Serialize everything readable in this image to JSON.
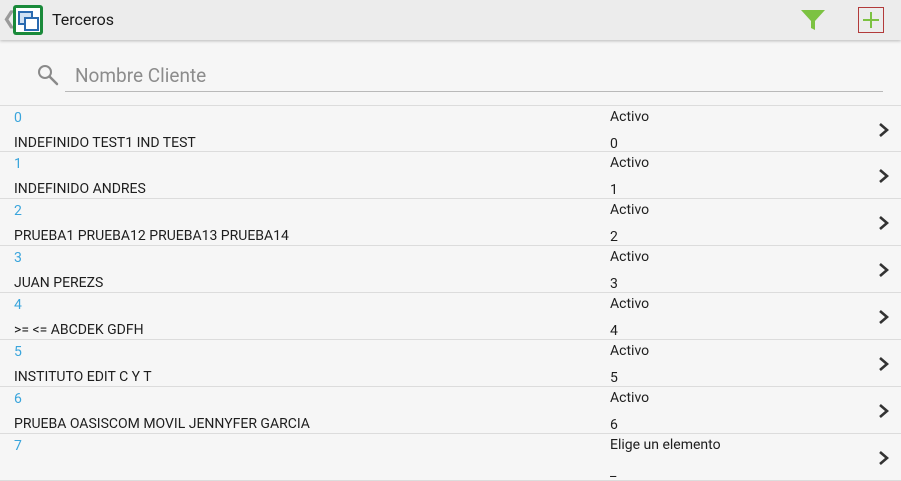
{
  "actionbar": {
    "up_caret": "❮",
    "title": "Terceros",
    "filter_icon_color": "#7cc242",
    "add_icon_color": "#7cc242",
    "app_icon": "app-window-icon"
  },
  "search": {
    "placeholder": "Nombre Cliente",
    "value": ""
  },
  "rows": [
    {
      "code": "0",
      "name": "INDEFINIDO TEST1 IND TEST",
      "status": "Activo",
      "value": "0"
    },
    {
      "code": "1",
      "name": "INDEFINIDO ANDRES",
      "status": "Activo",
      "value": "1"
    },
    {
      "code": "2",
      "name": "PRUEBA1 PRUEBA12 PRUEBA13 PRUEBA14",
      "status": "Activo",
      "value": "2"
    },
    {
      "code": "3",
      "name": "JUAN PEREZS",
      "status": "Activo",
      "value": "3"
    },
    {
      "code": "4",
      "name": ">= <= ABCDEK GDFH",
      "status": "Activo",
      "value": "4"
    },
    {
      "code": "5",
      "name": "INSTITUTO EDIT C Y T",
      "status": "Activo",
      "value": "5"
    },
    {
      "code": "6",
      "name": "PRUEBA OASISCOM MOVIL JENNYFER GARCIA",
      "status": "Activo",
      "value": "6"
    },
    {
      "code": "7",
      "name": "",
      "status": "Elige un elemento",
      "value": "_"
    }
  ],
  "colors": {
    "code_text": "#3aa5dc",
    "actionbar_bg": "#ececec",
    "page_bg": "#f6f6f6"
  }
}
